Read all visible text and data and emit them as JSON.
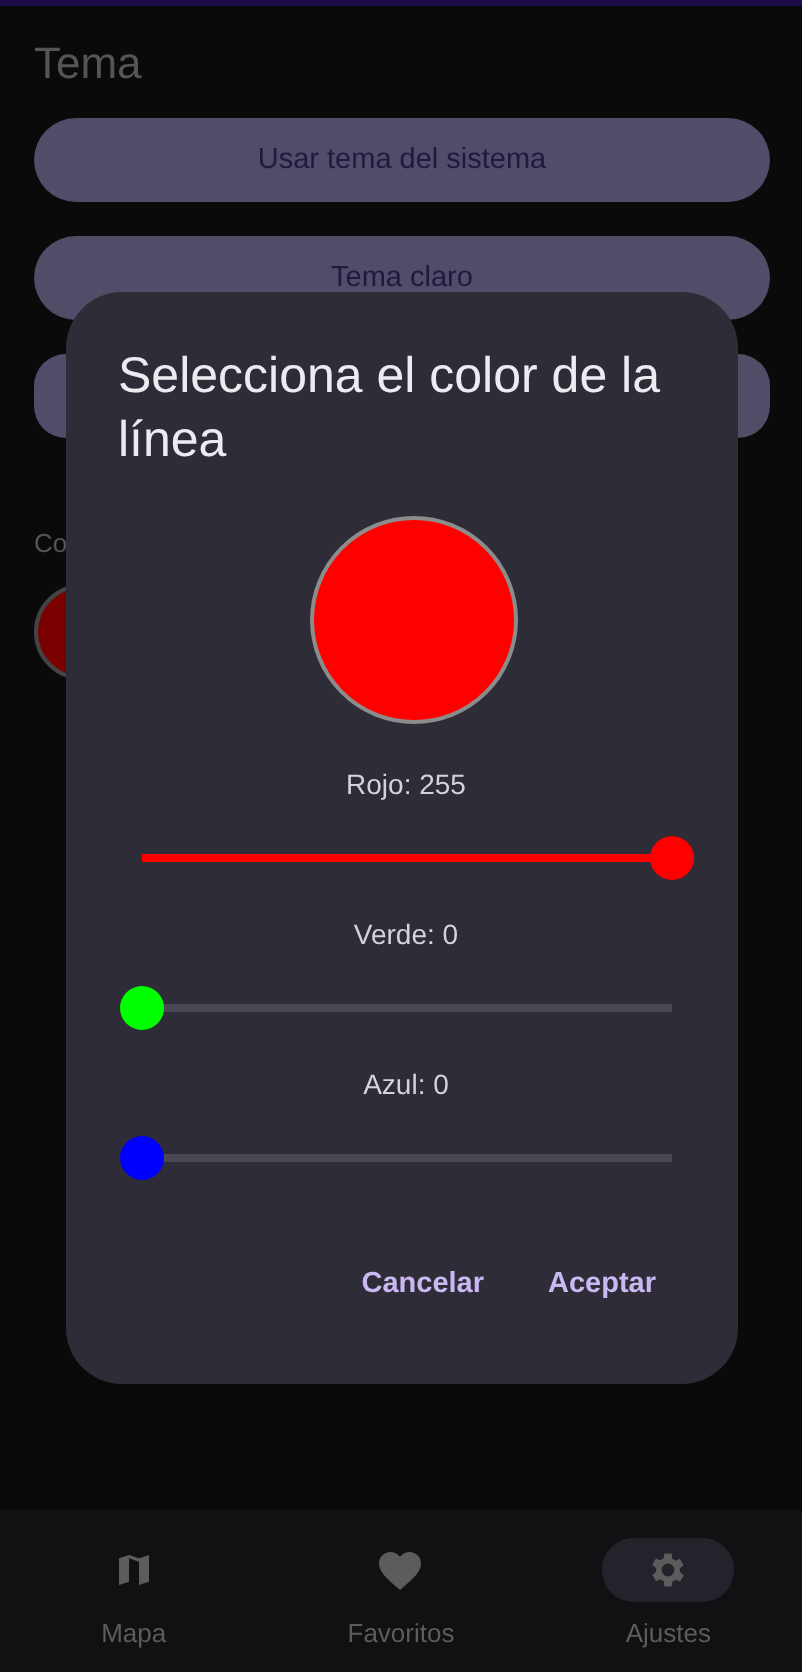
{
  "settings": {
    "section_title": "Tema",
    "theme_options": [
      {
        "label": "Usar tema del sistema"
      },
      {
        "label": "Tema claro"
      }
    ],
    "color_section_title": "Co",
    "line_color_swatch": {
      "color": "#7a0000"
    }
  },
  "dialog": {
    "title": "Selecciona el color de la línea",
    "sliders": [
      {
        "label": "Rojo: 255",
        "color": "#ff0000",
        "level": 1
      },
      {
        "label": "Verde: 0",
        "color": "#00ff00",
        "level": 0
      },
      {
        "label": "Azul: 0",
        "color": "#0000ff",
        "level": 0
      }
    ],
    "buttons": [
      "Cancelar",
      "Aceptar"
    ]
  },
  "bottom_nav": [
    {
      "label": "Mapa",
      "selected": false
    },
    {
      "label": "Favoritos",
      "selected": false
    },
    {
      "label": "Ajustes",
      "selected": true
    }
  ]
}
